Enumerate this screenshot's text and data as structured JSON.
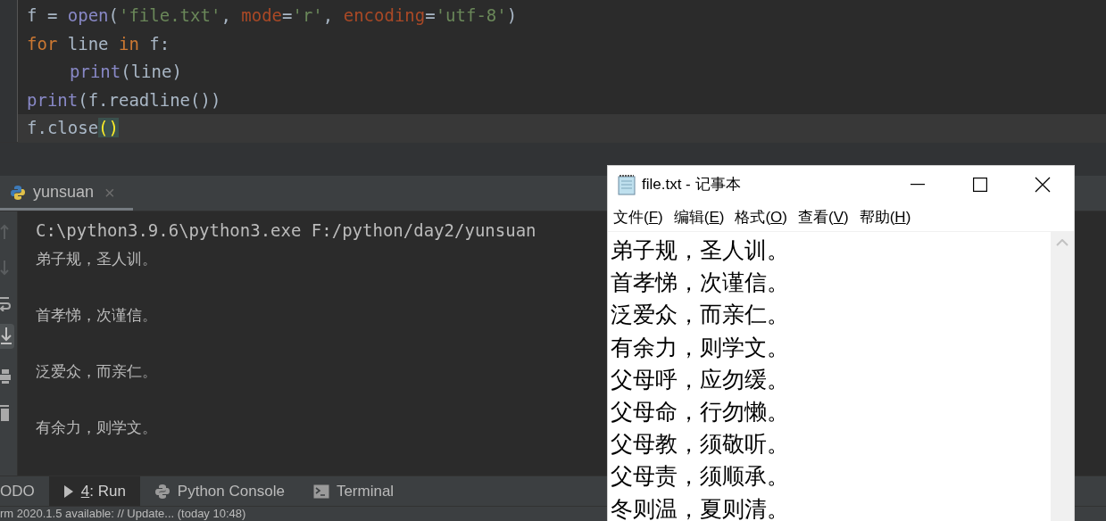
{
  "editor": {
    "lines": [
      {
        "current": false,
        "indent": false,
        "tokens": [
          {
            "kind": "plain",
            "text": "f = "
          },
          {
            "kind": "builtin",
            "text": "open"
          },
          {
            "kind": "plain",
            "text": "("
          },
          {
            "kind": "string",
            "text": "'file.txt'"
          },
          {
            "kind": "plain",
            "text": ", "
          },
          {
            "kind": "kwarg",
            "text": "mode"
          },
          {
            "kind": "plain",
            "text": "="
          },
          {
            "kind": "string",
            "text": "'r'"
          },
          {
            "kind": "plain",
            "text": ", "
          },
          {
            "kind": "kwarg",
            "text": "encoding"
          },
          {
            "kind": "plain",
            "text": "="
          },
          {
            "kind": "string",
            "text": "'utf-8'"
          },
          {
            "kind": "plain",
            "text": ")"
          }
        ]
      },
      {
        "current": false,
        "indent": false,
        "tokens": [
          {
            "kind": "keyword",
            "text": "for"
          },
          {
            "kind": "plain",
            "text": " line "
          },
          {
            "kind": "keyword",
            "text": "in"
          },
          {
            "kind": "plain",
            "text": " f:"
          }
        ]
      },
      {
        "current": false,
        "indent": true,
        "tokens": [
          {
            "kind": "builtin",
            "text": "print"
          },
          {
            "kind": "plain",
            "text": "(line)"
          }
        ]
      },
      {
        "current": false,
        "indent": false,
        "tokens": [
          {
            "kind": "builtin",
            "text": "print"
          },
          {
            "kind": "plain",
            "text": "(f.readline())"
          }
        ]
      },
      {
        "current": true,
        "indent": false,
        "tokens": [
          {
            "kind": "plain",
            "text": "f.close"
          },
          {
            "kind": "match",
            "text": "()"
          }
        ]
      }
    ]
  },
  "run_panel": {
    "tab": {
      "label": "yunsuan",
      "close": "×"
    },
    "console": [
      {
        "kind": "command",
        "text": "C:\\python3.9.6\\python3.exe F:/python/day2/yunsuan"
      },
      {
        "kind": "output",
        "text": "弟子规，圣人训。"
      },
      {
        "kind": "blank"
      },
      {
        "kind": "output",
        "text": "首孝悌，次谨信。"
      },
      {
        "kind": "blank"
      },
      {
        "kind": "output",
        "text": "泛爱众，而亲仁。"
      },
      {
        "kind": "blank"
      },
      {
        "kind": "output",
        "text": "有余力，则学文。"
      }
    ]
  },
  "tool_tabs": [
    {
      "kind": "plain",
      "label": "ODO",
      "selected": false
    },
    {
      "kind": "run",
      "key": "4",
      "label": ": Run",
      "selected": true
    },
    {
      "kind": "python",
      "label": "Python Console",
      "selected": false
    },
    {
      "kind": "terminal",
      "label": "Terminal",
      "selected": false
    }
  ],
  "status_bar": {
    "text": "rm 2020.1.5 available: // Update... (today 10:48)"
  },
  "notepad": {
    "title": "file.txt - 记事本",
    "menu": [
      {
        "label": "文件(",
        "key": "F",
        "end": ")"
      },
      {
        "label": "编辑(",
        "key": "E",
        "end": ")"
      },
      {
        "label": "格式(",
        "key": "O",
        "end": ")"
      },
      {
        "label": "查看(",
        "key": "V",
        "end": ")"
      },
      {
        "label": "帮助(",
        "key": "H",
        "end": ")"
      }
    ],
    "lines": [
      "弟子规，圣人训。",
      "首孝悌，次谨信。",
      "泛爱众，而亲仁。",
      "有余力，则学文。",
      "父母呼，应勿缓。",
      "父母命，行勿懒。",
      "父母教，须敬听。",
      "父母责，须顺承。",
      "冬则温，夏则清。"
    ]
  }
}
